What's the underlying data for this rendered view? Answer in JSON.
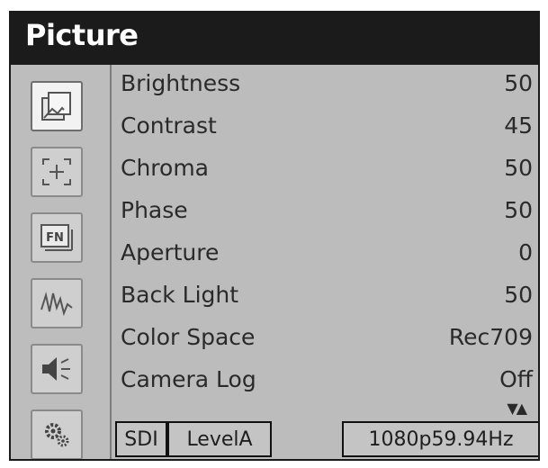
{
  "header": {
    "title": "Picture"
  },
  "sidebar": {
    "icons": [
      {
        "name": "picture-icon",
        "active": true
      },
      {
        "name": "marker-icon",
        "active": false
      },
      {
        "name": "fn-icon",
        "label": "FN",
        "active": false
      },
      {
        "name": "waveform-icon",
        "active": false
      },
      {
        "name": "audio-icon",
        "active": false
      },
      {
        "name": "system-icon",
        "active": false
      }
    ]
  },
  "menu": {
    "items": [
      {
        "label": "Brightness",
        "value": "50"
      },
      {
        "label": "Contrast",
        "value": "45"
      },
      {
        "label": "Chroma",
        "value": "50"
      },
      {
        "label": "Phase",
        "value": "50"
      },
      {
        "label": "Aperture",
        "value": "0"
      },
      {
        "label": "Back Light",
        "value": "50"
      },
      {
        "label": "Color Space",
        "value": "Rec709"
      },
      {
        "label": "Camera Log",
        "value": "Off"
      }
    ],
    "scroll_arrows": "▼▲"
  },
  "status_bar": {
    "input": "SDI",
    "level": "LevelA",
    "format": "1080p59.94Hz"
  }
}
